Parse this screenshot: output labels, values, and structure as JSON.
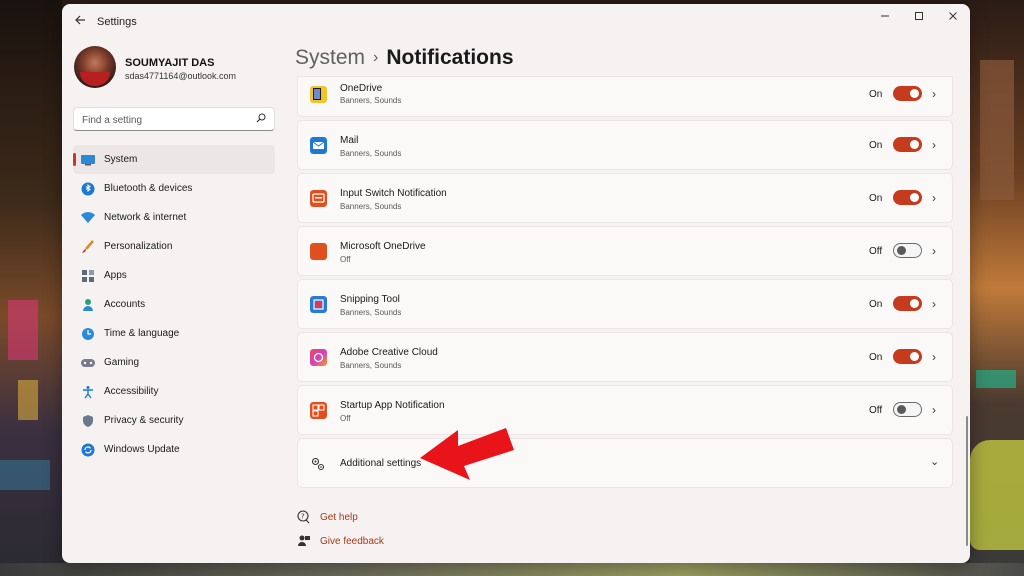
{
  "window": {
    "title": "Settings"
  },
  "profile": {
    "name": "SOUMYAJIT DAS",
    "email": "sdas4771164@outlook.com"
  },
  "search": {
    "placeholder": "Find a setting"
  },
  "nav": [
    {
      "label": "System",
      "icon": "system-icon",
      "active": true
    },
    {
      "label": "Bluetooth & devices",
      "icon": "bluetooth-icon"
    },
    {
      "label": "Network & internet",
      "icon": "wifi-icon"
    },
    {
      "label": "Personalization",
      "icon": "paintbrush-icon"
    },
    {
      "label": "Apps",
      "icon": "apps-icon"
    },
    {
      "label": "Accounts",
      "icon": "accounts-icon"
    },
    {
      "label": "Time & language",
      "icon": "globe-clock-icon"
    },
    {
      "label": "Gaming",
      "icon": "gamepad-icon"
    },
    {
      "label": "Accessibility",
      "icon": "accessibility-icon"
    },
    {
      "label": "Privacy & security",
      "icon": "shield-icon"
    },
    {
      "label": "Windows Update",
      "icon": "update-icon"
    }
  ],
  "header": {
    "parent": "System",
    "separator": "›",
    "current": "Notifications"
  },
  "apps": [
    {
      "name": "OneDrive",
      "sub": "Banners, Sounds",
      "state": "On",
      "on": true,
      "color": "#f3c32a"
    },
    {
      "name": "Mail",
      "sub": "Banners, Sounds",
      "state": "On",
      "on": true,
      "color": "#1e78d4"
    },
    {
      "name": "Input Switch Notification",
      "sub": "Banners, Sounds",
      "state": "On",
      "on": true,
      "color": "#e0501e"
    },
    {
      "name": "Microsoft OneDrive",
      "sub": "Off",
      "state": "Off",
      "on": false,
      "color": "#e0501e"
    },
    {
      "name": "Snipping Tool",
      "sub": "Banners, Sounds",
      "state": "On",
      "on": true,
      "color": "#2a7ad4"
    },
    {
      "name": "Adobe Creative Cloud",
      "sub": "Banners, Sounds",
      "state": "On",
      "on": true,
      "color": "#e0365a"
    },
    {
      "name": "Startup App Notification",
      "sub": "Off",
      "state": "Off",
      "on": false,
      "color": "#e0501e"
    }
  ],
  "additional": {
    "label": "Additional settings"
  },
  "footer": {
    "help": "Get help",
    "feedback": "Give feedback"
  },
  "colors": {
    "accent": "#c63a1e",
    "annotation": "#e8141a"
  }
}
